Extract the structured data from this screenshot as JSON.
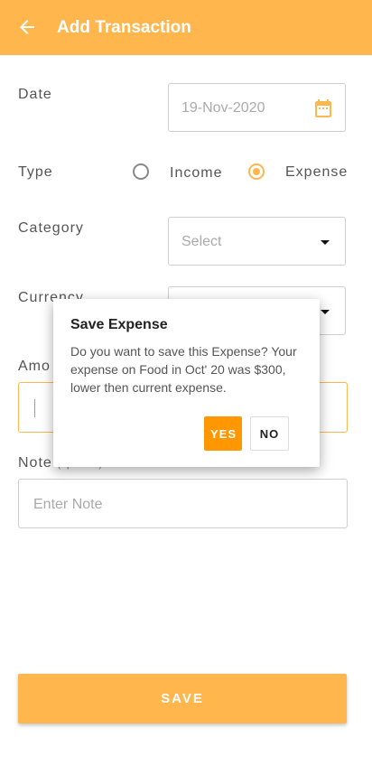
{
  "header": {
    "title": "Add Transaction",
    "back_icon": "arrow-left-icon"
  },
  "form": {
    "date": {
      "label": "Date",
      "value": "19-Nov-2020",
      "icon": "calendar-icon"
    },
    "type": {
      "label": "Type",
      "options": [
        {
          "label": "Income",
          "selected": false
        },
        {
          "label": "Expense",
          "selected": true
        }
      ]
    },
    "category": {
      "label": "Category",
      "placeholder": "Select"
    },
    "currency": {
      "label": "Currency",
      "value": ""
    },
    "amount": {
      "label": "Amo",
      "value": ""
    },
    "note": {
      "label": "Note",
      "optional": "(optional)",
      "placeholder": "Enter Note"
    },
    "save_label": "SAVE"
  },
  "dialog": {
    "title": "Save Expense",
    "message": "Do you want to save this Expense? Your expense on Food in Oct' 20 was $300, lower then current expense.",
    "yes_label": "YES",
    "no_label": "NO"
  },
  "colors": {
    "accent": "#FFB74D",
    "dialog_yes": "#FF9800"
  }
}
